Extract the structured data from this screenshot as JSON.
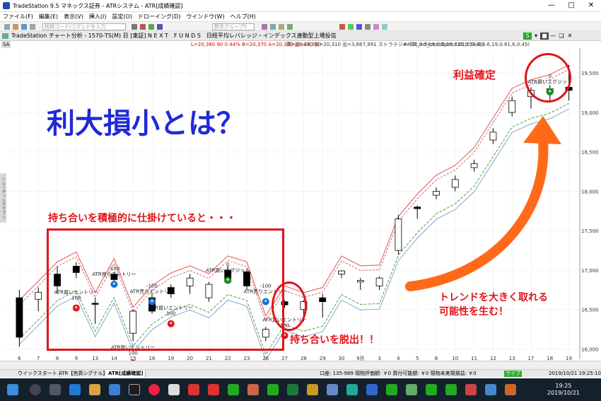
{
  "window": {
    "title": "TradeStation 9.5 マネックス証券 - ATRシステム - ATR[成績確認]"
  },
  "menu": [
    "ファイル(F)",
    "編集(E)",
    "表示(V)",
    "挿入(I)",
    "設定(O)",
    "ドローイング(D)",
    "ウインドウ(W)",
    "ヘルプ(H)"
  ],
  "toolbar": {
    "symbol_placeholder": "銘柄コード/コマンドを入力",
    "pane_placeholder": "数字グループ5"
  },
  "chart_header": {
    "title": "TradeStation チャート分析 - 1570-TS(M) 日 [東証] N E X T　F U N D S　日経平均レバレッジ・インデックス連動型上場投信",
    "s_badge": "S"
  },
  "data_line": {
    "sa": "SA",
    "values": "L=20,380  90  0.44%   B=20,370  A=20,390  出=20,350",
    "values2": "高=20,430  安=20,310  出=3,667,991  ストラテジー (12,0.54,9,0.6,19,0.81,6,0.45)",
    "strategy": "#ATR_ind_nextOpen (12,0.54,9,0.6,19,0.81,6,0.45)"
  },
  "side_tab": "トレーディングアプリ",
  "chart_data": {
    "type": "candlestick",
    "x_labels": [
      "6",
      "7",
      "8",
      "9",
      "13",
      "14",
      "15",
      "16",
      "19",
      "20",
      "21",
      "22",
      "23",
      "26",
      "27",
      "28",
      "29",
      "30",
      "9月",
      "3",
      "4",
      "5",
      "6",
      "10",
      "11",
      "12",
      "13",
      "17",
      "18",
      "19"
    ],
    "y_ticks": [
      16000,
      16500,
      17000,
      17500,
      18000,
      18500,
      19000,
      19500
    ],
    "ylim": [
      15870,
      19780
    ],
    "candles": [
      {
        "o": 16650,
        "h": 16750,
        "l": 16030,
        "c": 16150
      },
      {
        "o": 16630,
        "h": 16780,
        "l": 16480,
        "c": 16720
      },
      {
        "o": 16950,
        "h": 17050,
        "l": 16700,
        "c": 16800
      },
      {
        "o": 17050,
        "h": 17100,
        "l": 16900,
        "c": 16970
      },
      {
        "o": 16580,
        "h": 16650,
        "l": 16320,
        "c": 16570
      },
      {
        "o": 16950,
        "h": 16980,
        "l": 16850,
        "c": 16880
      },
      {
        "o": 16200,
        "h": 16500,
        "l": 16100,
        "c": 16480
      },
      {
        "o": 16650,
        "h": 16700,
        "l": 16450,
        "c": 16480
      },
      {
        "o": 16780,
        "h": 16820,
        "l": 16650,
        "c": 16700
      },
      {
        "o": 16800,
        "h": 16950,
        "l": 16700,
        "c": 16900
      },
      {
        "o": 16650,
        "h": 16850,
        "l": 16600,
        "c": 16820
      },
      {
        "o": 17000,
        "h": 17050,
        "l": 16850,
        "c": 16850
      },
      {
        "o": 16980,
        "h": 17000,
        "l": 16750,
        "c": 16800
      },
      {
        "o": 16150,
        "h": 16280,
        "l": 16100,
        "c": 16250
      },
      {
        "o": 16600,
        "h": 16620,
        "l": 16520,
        "c": 16560
      },
      {
        "o": 16500,
        "h": 16620,
        "l": 16350,
        "c": 16600
      },
      {
        "o": 16650,
        "h": 16700,
        "l": 16400,
        "c": 16600
      },
      {
        "o": 16950,
        "h": 17000,
        "l": 16900,
        "c": 16990
      },
      {
        "o": 16850,
        "h": 16900,
        "l": 16750,
        "c": 16870
      },
      {
        "o": 16800,
        "h": 16920,
        "l": 16750,
        "c": 16900
      },
      {
        "o": 17250,
        "h": 17700,
        "l": 17200,
        "c": 17650
      },
      {
        "o": 17800,
        "h": 17820,
        "l": 17650,
        "c": 17780
      },
      {
        "o": 17950,
        "h": 18050,
        "l": 17900,
        "c": 18000
      },
      {
        "o": 18050,
        "h": 18200,
        "l": 18000,
        "c": 18150
      },
      {
        "o": 18300,
        "h": 18400,
        "l": 18250,
        "c": 18350
      },
      {
        "o": 18650,
        "h": 18800,
        "l": 18600,
        "c": 18750
      },
      {
        "o": 19000,
        "h": 19200,
        "l": 18950,
        "c": 19150
      },
      {
        "o": 19200,
        "h": 19320,
        "l": 19050,
        "c": 19280
      },
      {
        "o": 19250,
        "h": 19350,
        "l": 19150,
        "c": 19300
      },
      {
        "o": 19320,
        "h": 19600,
        "l": 19150,
        "c": 19280
      }
    ],
    "trade_labels": [
      {
        "text": "ATR買いエントリー",
        "sub": "100",
        "i": 3,
        "y": 16700
      },
      {
        "text": "-100",
        "sub": "ATR売りエントリー",
        "i": 5,
        "y": 17000
      },
      {
        "text": "-100",
        "sub": "ATR売りエントリー",
        "i": 7,
        "y": 16780
      },
      {
        "text": "ATR買いエントリー",
        "sub": "100",
        "i": 8,
        "y": 16500
      },
      {
        "text": "0",
        "sub": "ATR買いエグジット",
        "i": 11,
        "y": 17050
      },
      {
        "text": "-100",
        "sub": "ATR売りエントリー",
        "i": 13,
        "y": 16780
      },
      {
        "text": "ATR買いエントリー",
        "sub": "100",
        "i": 14,
        "y": 16350
      },
      {
        "text": "ATR買いエントリー",
        "sub": "100",
        "i": 6,
        "y": 16000
      },
      {
        "text": "0",
        "sub": "ATR買いエグジット",
        "i": 28,
        "y": 19440
      }
    ]
  },
  "annotations": {
    "headline": "利大損小とは？",
    "box_caption": "持ち合いを積極的に仕掛けていると・・・",
    "breakout": "持ち合いを脱出！！",
    "trend_line1": "トレンドを大きく取れる",
    "trend_line2": "可能性を生む！",
    "profit": "利益確定"
  },
  "tabs": [
    "ウイックスタート",
    "ATR【売買シグナル】",
    "ATR[成績確認]"
  ],
  "status": "口座: 135-989   現物評価額: ￥0 買付可能額: ￥0  現物未実現損益: ￥0",
  "live_badge": "ライブ",
  "status_datetime": "2019/10/21 19:25:10",
  "clock": {
    "time": "19:25",
    "date": "2019/10/21"
  }
}
